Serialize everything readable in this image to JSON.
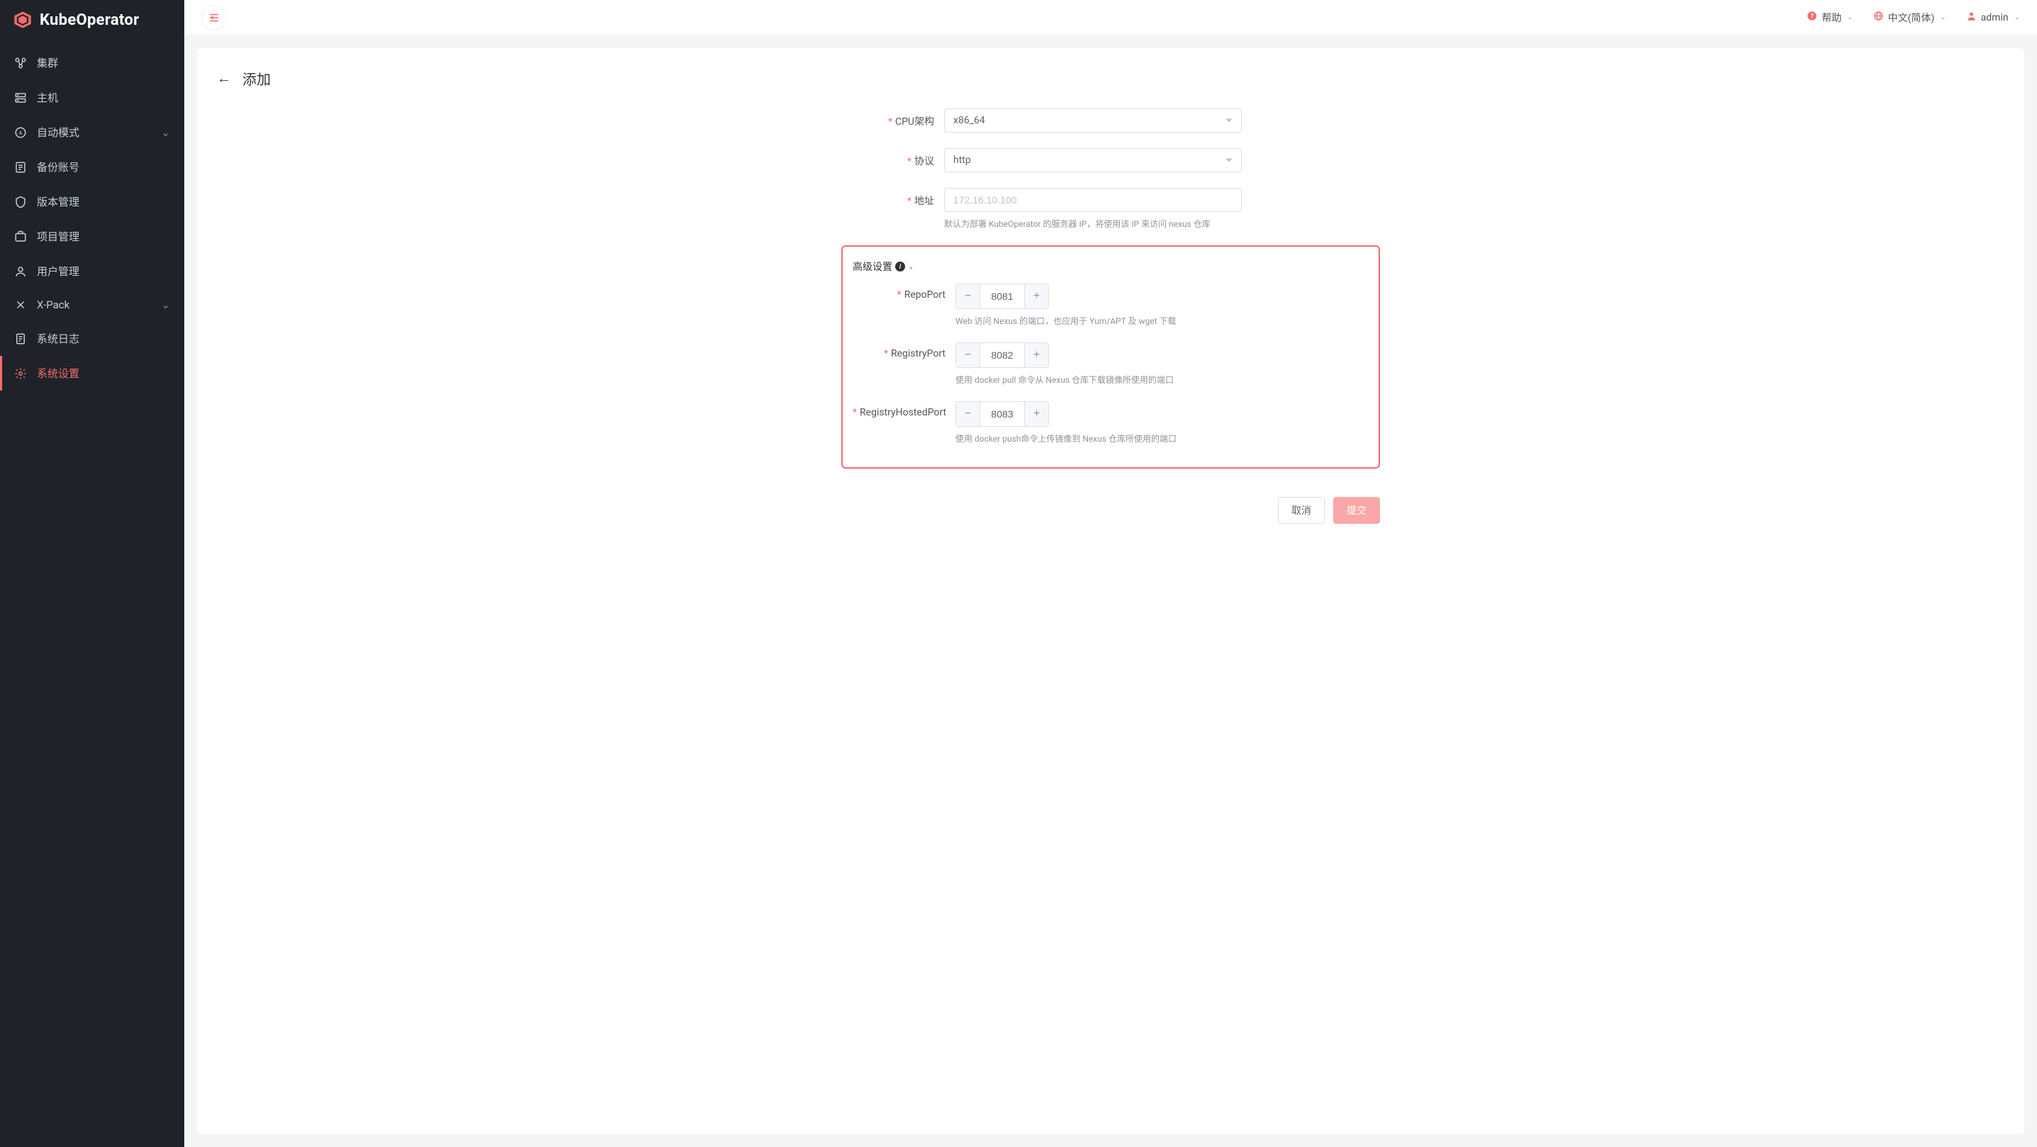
{
  "brand": "KubeOperator",
  "header": {
    "help": "帮助",
    "language": "中文(简体)",
    "user": "admin"
  },
  "sidebar": {
    "items": [
      {
        "label": "集群",
        "icon": "cluster"
      },
      {
        "label": "主机",
        "icon": "host"
      },
      {
        "label": "自动模式",
        "icon": "auto",
        "expandable": true
      },
      {
        "label": "备份账号",
        "icon": "backup"
      },
      {
        "label": "版本管理",
        "icon": "version"
      },
      {
        "label": "项目管理",
        "icon": "project"
      },
      {
        "label": "用户管理",
        "icon": "user"
      },
      {
        "label": "X-Pack",
        "icon": "xpack",
        "expandable": true
      },
      {
        "label": "系统日志",
        "icon": "log"
      },
      {
        "label": "系统设置",
        "icon": "settings",
        "active": true
      }
    ]
  },
  "page": {
    "title": "添加",
    "fields": {
      "cpu_arch": {
        "label": "CPU架构",
        "value": "x86_64"
      },
      "protocol": {
        "label": "协议",
        "value": "http"
      },
      "address": {
        "label": "地址",
        "placeholder": "172.16.10.100",
        "hint": "默认为部署 KubeOperator 的服务器 IP，将使用该 IP 来访问 nexus 仓库"
      }
    },
    "advanced": {
      "title": "高级设置",
      "repo_port": {
        "label": "RepoPort",
        "value": "8081",
        "hint": "Web 访问 Nexus 的端口，也应用于 Yum/APT 及 wget 下载"
      },
      "registry_port": {
        "label": "RegistryPort",
        "value": "8082",
        "hint": "使用 docker pull 命令从 Nexus 仓库下载镜像所使用的端口"
      },
      "registry_hosted_port": {
        "label": "RegistryHostedPort",
        "value": "8083",
        "hint": "使用 docker push命令上传镜像到 Nexus 仓库所使用的端口"
      }
    },
    "actions": {
      "cancel": "取消",
      "submit": "提交"
    }
  }
}
